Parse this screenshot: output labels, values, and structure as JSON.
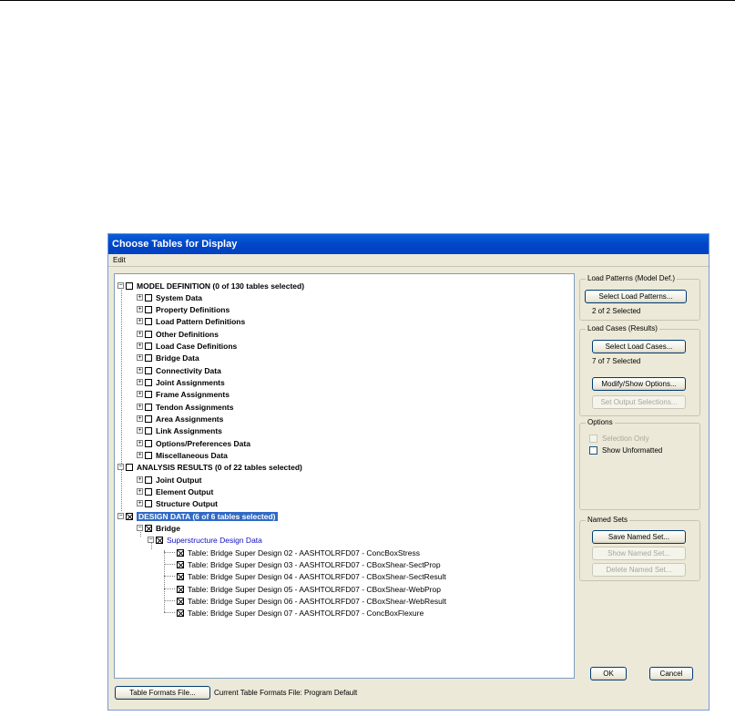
{
  "dialog": {
    "title": "Choose Tables for Display",
    "menu": [
      "Edit"
    ]
  },
  "tree": {
    "model_definition": {
      "label": "MODEL DEFINITION  (0 of 130 tables selected)",
      "children": [
        "System Data",
        "Property Definitions",
        "Load Pattern Definitions",
        "Other Definitions",
        "Load Case Definitions",
        "Bridge Data",
        "Connectivity Data",
        "Joint Assignments",
        "Frame Assignments",
        "Tendon Assignments",
        "Area Assignments",
        "Link Assignments",
        "Options/Preferences Data",
        "Miscellaneous Data"
      ]
    },
    "analysis_results": {
      "label": "ANALYSIS RESULTS  (0 of 22 tables selected)",
      "children": [
        "Joint Output",
        "Element Output",
        "Structure Output"
      ]
    },
    "design_data": {
      "label": "DESIGN DATA  (6 of 6 tables selected)",
      "bridge": "Bridge",
      "superstructure": "Superstructure Design Data",
      "tables": [
        "Table:  Bridge Super Design 02 - AASHTOLRFD07 - ConcBoxStress",
        "Table:  Bridge Super Design 03 - AASHTOLRFD07 - CBoxShear-SectProp",
        "Table:  Bridge Super Design 04 - AASHTOLRFD07 - CBoxShear-SectResult",
        "Table:  Bridge Super Design 05 - AASHTOLRFD07 - CBoxShear-WebProp",
        "Table:  Bridge Super Design 06 - AASHTOLRFD07 - CBoxShear-WebResult",
        "Table:  Bridge Super Design 07 - AASHTOLRFD07 - ConcBoxFlexure"
      ]
    }
  },
  "load_patterns": {
    "title": "Load Patterns (Model Def.)",
    "button": "Select Load Patterns...",
    "status": "2 of 2 Selected"
  },
  "load_cases": {
    "title": "Load Cases (Results)",
    "button": "Select Load Cases...",
    "status": "7 of 7 Selected",
    "modify_button": "Modify/Show Options...",
    "output_button": "Set Output Selections..."
  },
  "options": {
    "title": "Options",
    "selection_only": "Selection Only",
    "show_unformatted": "Show Unformatted"
  },
  "named_sets": {
    "title": "Named Sets",
    "save": "Save Named Set...",
    "show": "Show Named Set...",
    "delete": "Delete Named Set..."
  },
  "footer": {
    "table_formats_button": "Table Formats File...",
    "current_label": "Current Table Formats File:  Program Default",
    "ok": "OK",
    "cancel": "Cancel"
  }
}
